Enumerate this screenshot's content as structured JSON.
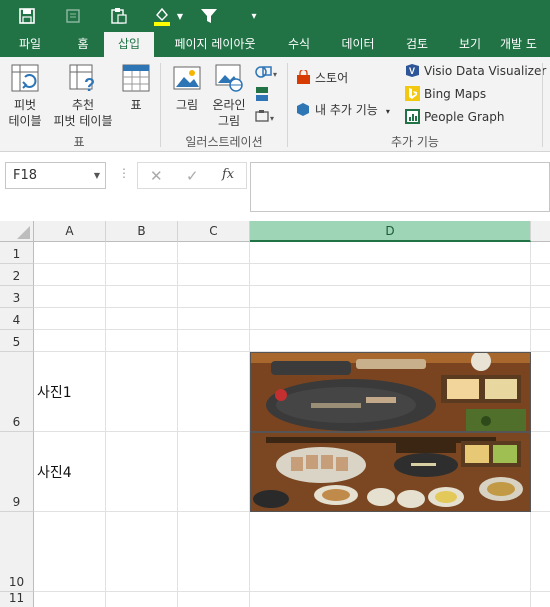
{
  "quick_access": {
    "save_icon": "save-icon",
    "undo_icon": "undo-icon",
    "paste_icon": "paste-icon",
    "fill_icon": "fill-color-icon",
    "filter_icon": "filter-icon",
    "customize_icon": "customize-toolbar-icon"
  },
  "tabs": [
    {
      "label": "파일"
    },
    {
      "label": "홈"
    },
    {
      "label": "삽입"
    },
    {
      "label": "페이지 레이아웃"
    },
    {
      "label": "수식"
    },
    {
      "label": "데이터"
    },
    {
      "label": "검토"
    },
    {
      "label": "보기"
    },
    {
      "label": "개발 도"
    }
  ],
  "ribbon": {
    "pivot_line1": "피벗",
    "pivot_line2": "테이블",
    "rec_line1": "추천",
    "rec_line2": "피벗 테이블",
    "table": "표",
    "table_group": "표",
    "picture": "그림",
    "online_line1": "온라인",
    "online_line2": "그림",
    "illustrations_group": "일러스트레이션",
    "store": "스토어",
    "my_addins": "내 추가 기능",
    "visio": "Visio Data Visualizer",
    "bing": "Bing Maps",
    "people": "People Graph",
    "addins_group": "추가 기능"
  },
  "formula_bar": {
    "name_box": "F18",
    "fx": "fx",
    "formula": ""
  },
  "sheet": {
    "columns": [
      "A",
      "B",
      "C",
      "D"
    ],
    "rows": [
      "1",
      "2",
      "3",
      "4",
      "5",
      "6",
      "9",
      "10",
      "11"
    ],
    "a6": "사진1",
    "a9": "사진4"
  },
  "colors": {
    "excel_green": "#217346",
    "selected_header": "#9fd5b7"
  }
}
